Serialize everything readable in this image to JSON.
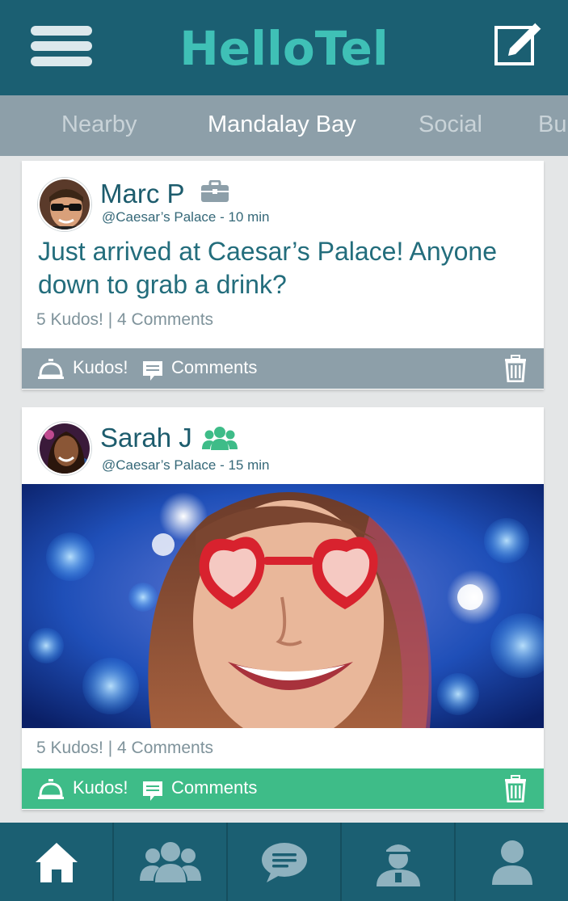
{
  "app": {
    "title": "HelloTel"
  },
  "tabs": [
    {
      "label": "Nearby",
      "active": false
    },
    {
      "label": "Mandalay Bay",
      "active": true
    },
    {
      "label": "Social",
      "active": false
    },
    {
      "label": "Bu",
      "active": false
    }
  ],
  "posts": [
    {
      "author": "Marc P",
      "type_icon": "briefcase-icon",
      "location": "@Caesar’s Palace - 10 min",
      "text": "Just arrived at Caesar’s Palace! Anyone down to grab a drink?",
      "stats": "5 Kudos! | 4 Comments",
      "kudos_label": "Kudos!",
      "comments_label": "Comments",
      "action_bar_color": "#8d9fa9"
    },
    {
      "author": "Sarah J",
      "type_icon": "group-icon",
      "location": "@Caesar’s Palace - 15 min",
      "stats": "5 Kudos! | 4 Comments",
      "kudos_label": "Kudos!",
      "comments_label": "Comments",
      "action_bar_color": "#3ebc88"
    }
  ],
  "bottom_nav": [
    {
      "icon": "home-icon",
      "active": true
    },
    {
      "icon": "people-icon",
      "active": false
    },
    {
      "icon": "chat-bubble-icon",
      "active": false
    },
    {
      "icon": "concierge-icon",
      "active": false
    },
    {
      "icon": "profile-icon",
      "active": false
    }
  ],
  "colors": {
    "header": "#1b5f72",
    "logo": "#3fc0b6",
    "tabs_bg": "#8d9fa9",
    "accent_green": "#3ebc88",
    "text_teal": "#1d5c6d"
  }
}
